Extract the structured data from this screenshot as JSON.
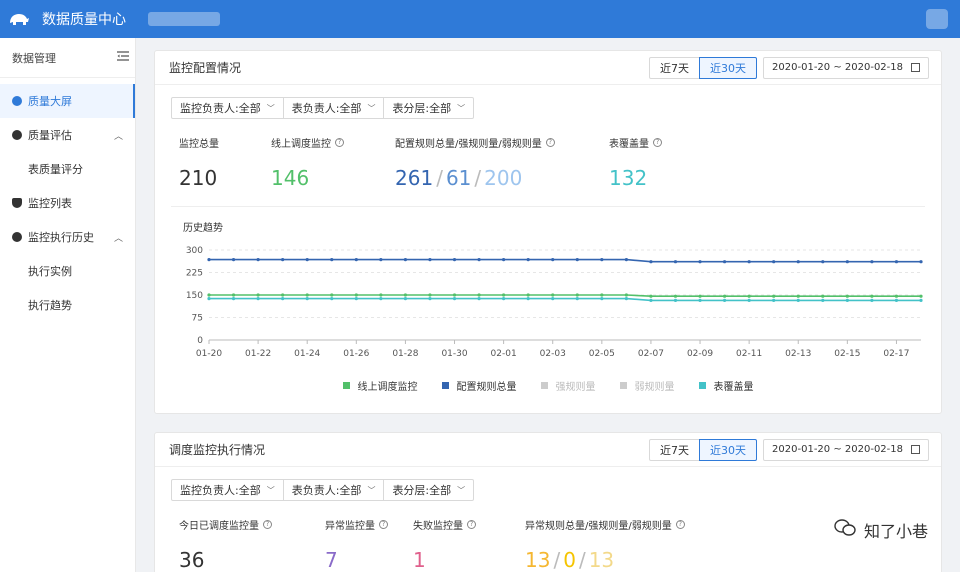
{
  "app": {
    "title": "数据质量中心"
  },
  "sidebar": {
    "header": "数据管理",
    "items": [
      {
        "label": "质量大屏"
      },
      {
        "label": "质量评估"
      },
      {
        "label": "表质量评分"
      },
      {
        "label": "监控列表"
      },
      {
        "label": "监控执行历史"
      },
      {
        "label": "执行实例"
      },
      {
        "label": "执行趋势"
      }
    ]
  },
  "card1": {
    "title": "监控配置情况",
    "range_7": "近7天",
    "range_30": "近30天",
    "date_range": "2020-01-20 ~ 2020-02-18",
    "filters": [
      "监控负责人:全部",
      "表负责人:全部",
      "表分层:全部"
    ],
    "stats": [
      {
        "label": "监控总量",
        "value": "210"
      },
      {
        "label": "线上调度监控",
        "value": "146"
      },
      {
        "label": "配置规则总量/强规则量/弱规则量",
        "v1": "261",
        "v2": "61",
        "v3": "200"
      },
      {
        "label": "表覆盖量",
        "value": "132"
      }
    ],
    "chart_title": "历史趋势"
  },
  "card2": {
    "title": "调度监控执行情况",
    "range_7": "近7天",
    "range_30": "近30天",
    "date_range": "2020-01-20 ~ 2020-02-18",
    "filters": [
      "监控负责人:全部",
      "表负责人:全部",
      "表分层:全部"
    ],
    "stats": [
      {
        "label": "今日已调度监控量",
        "value": "36"
      },
      {
        "label": "异常监控量",
        "value": "7"
      },
      {
        "label": "失败监控量",
        "value": "1"
      },
      {
        "label": "异常规则总量/强规则量/弱规则量",
        "v1": "13",
        "v2": "0",
        "v3": "13"
      }
    ]
  },
  "watermark": "知了小巷",
  "colors": {
    "primary": "#2f7ad8",
    "green": "#52c06a",
    "blue": "#3465b0",
    "teal": "#43c2c8",
    "purple": "#8a6bc9",
    "pink": "#e0608c",
    "orange": "#f5b731"
  },
  "chart_data": {
    "type": "line",
    "title": "历史趋势",
    "x": [
      "01-20",
      "01-21",
      "01-22",
      "01-23",
      "01-24",
      "01-25",
      "01-26",
      "01-27",
      "01-28",
      "01-29",
      "01-30",
      "01-31",
      "02-01",
      "02-02",
      "02-03",
      "02-04",
      "02-05",
      "02-06",
      "02-07",
      "02-08",
      "02-09",
      "02-10",
      "02-11",
      "02-12",
      "02-13",
      "02-14",
      "02-15",
      "02-16",
      "02-17",
      "02-18"
    ],
    "xticks": [
      "01-20",
      "01-22",
      "01-24",
      "01-26",
      "01-28",
      "01-30",
      "02-01",
      "02-03",
      "02-05",
      "02-07",
      "02-09",
      "02-11",
      "02-13",
      "02-15",
      "02-17"
    ],
    "yticks": [
      0,
      75,
      150,
      225,
      300
    ],
    "ylim": [
      0,
      300
    ],
    "series": [
      {
        "name": "线上调度监控",
        "color": "#52c06a",
        "visible": true,
        "values": [
          150,
          150,
          150,
          150,
          150,
          150,
          150,
          150,
          150,
          150,
          150,
          150,
          150,
          150,
          150,
          150,
          150,
          150,
          146,
          146,
          146,
          146,
          146,
          146,
          146,
          146,
          146,
          146,
          146,
          146
        ]
      },
      {
        "name": "配置规则总量",
        "color": "#3465b0",
        "visible": true,
        "values": [
          268,
          268,
          268,
          268,
          268,
          268,
          268,
          268,
          268,
          268,
          268,
          268,
          268,
          268,
          268,
          268,
          268,
          268,
          261,
          261,
          261,
          261,
          261,
          261,
          261,
          261,
          261,
          261,
          261,
          261
        ]
      },
      {
        "name": "强规则量",
        "color": "#c8c8c8",
        "visible": false,
        "values": []
      },
      {
        "name": "弱规则量",
        "color": "#c8c8c8",
        "visible": false,
        "values": []
      },
      {
        "name": "表覆盖量",
        "color": "#43c2c8",
        "visible": true,
        "values": [
          138,
          138,
          138,
          138,
          138,
          138,
          138,
          138,
          138,
          138,
          138,
          138,
          138,
          138,
          138,
          138,
          138,
          138,
          132,
          132,
          132,
          132,
          132,
          132,
          132,
          132,
          132,
          132,
          132,
          132
        ]
      }
    ]
  }
}
